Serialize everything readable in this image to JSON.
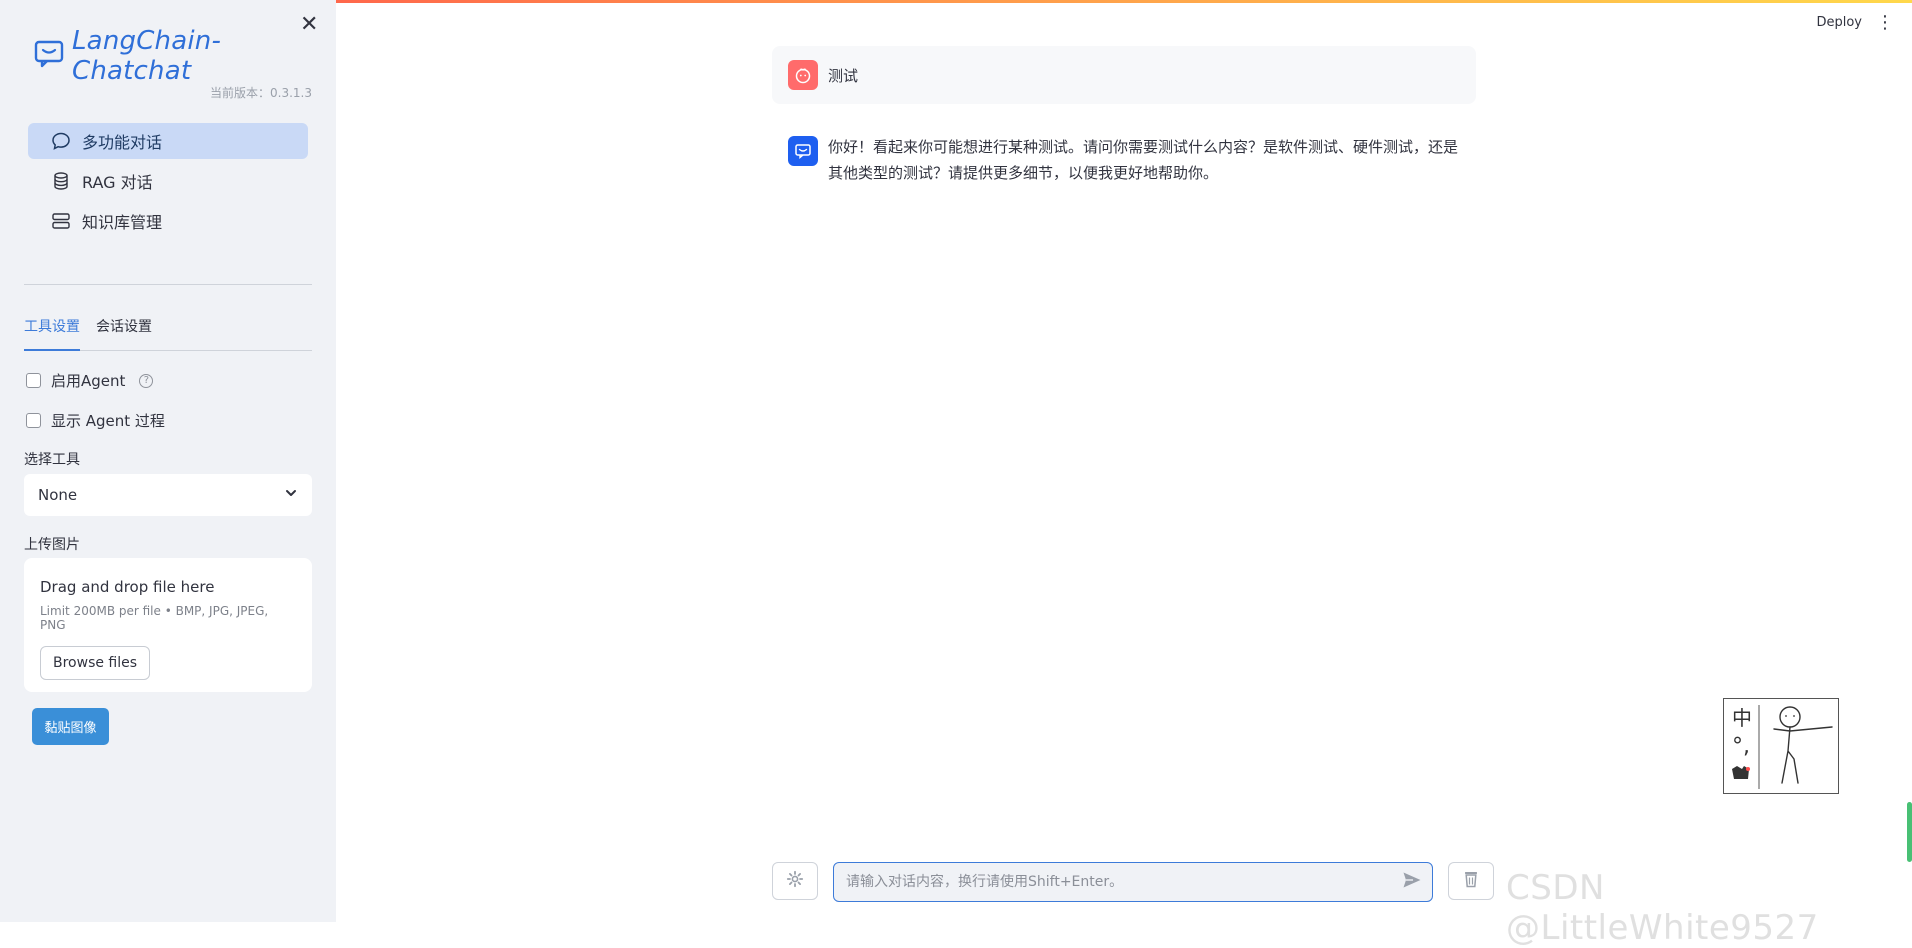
{
  "sidebar": {
    "close_icon": "close-icon",
    "logo_text": "LangChain-Chatchat",
    "version": "当前版本：0.3.1.3",
    "nav": [
      {
        "label": "多功能对话",
        "icon": "chat-bubble-icon",
        "active": true
      },
      {
        "label": "RAG 对话",
        "icon": "database-icon",
        "active": false
      },
      {
        "label": "知识库管理",
        "icon": "server-icon",
        "active": false
      }
    ],
    "tabs": [
      "工具设置",
      "会话设置"
    ],
    "checkboxes": [
      {
        "label": "启用Agent",
        "checked": false
      },
      {
        "label": "显示 Agent 过程",
        "checked": false
      }
    ],
    "help_glyph": "?",
    "select_tool_label": "选择工具",
    "select_tool_value": "None",
    "upload_label": "上传图片",
    "uploader": {
      "drag_text": "Drag and drop file here",
      "limit_text": "Limit 200MB per file • BMP, JPG, JPEG, PNG",
      "browse_label": "Browse files"
    },
    "paste_button": "黏贴图像"
  },
  "header": {
    "deploy_label": "Deploy",
    "menu_glyph": "⋮"
  },
  "messages": [
    {
      "role": "user",
      "text": "测试"
    },
    {
      "role": "assistant",
      "text": "你好！看起来你可能想进行某种测试。请问你需要测试什么内容？是软件测试、硬件测试，还是其他类型的测试？请提供更多细节，以便我更好地帮助你。"
    }
  ],
  "chat_input": {
    "placeholder": "请输入对话内容，换行请使用Shift+Enter。"
  },
  "sketch_text": [
    "中",
    "°,"
  ],
  "watermark": "CSDN @LittleWhite9527",
  "colors": {
    "accent": "#3d7bd9",
    "active_nav": "#c9d9f6",
    "paste_button": "#3a8fd8",
    "user_avatar": "#ff6b6b",
    "bot_avatar": "#1e5ff0"
  }
}
